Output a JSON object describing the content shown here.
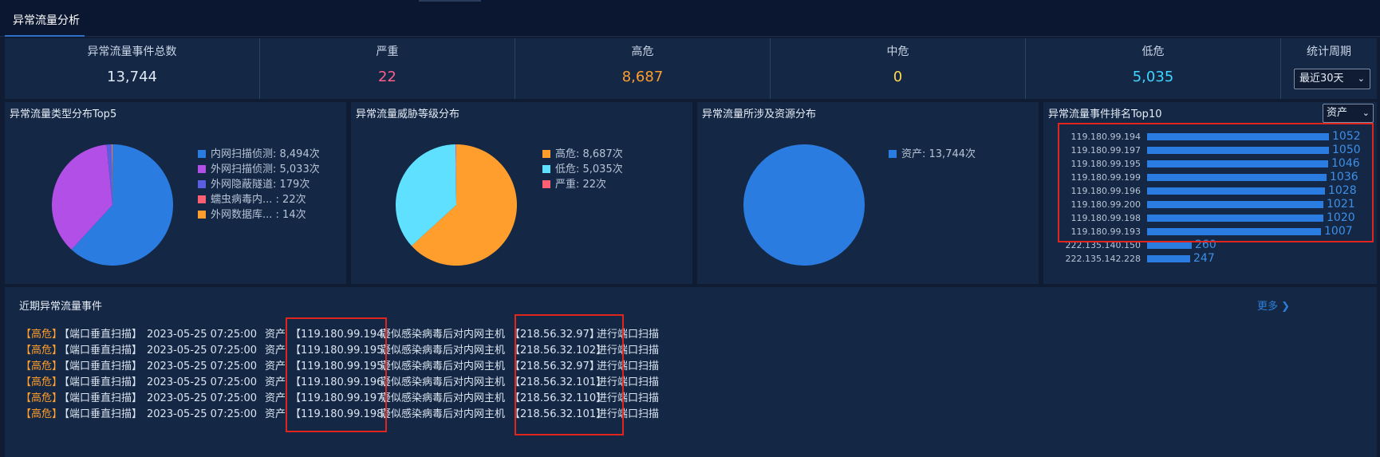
{
  "tab": {
    "label": "异常流量分析"
  },
  "stats": [
    {
      "label": "异常流量事件总数",
      "value": "13,744",
      "color": "#dfe7f3"
    },
    {
      "label": "严重",
      "value": "22",
      "color": "#ff5f8a"
    },
    {
      "label": "高危",
      "value": "8,687",
      "color": "#ff9e2c"
    },
    {
      "label": "中危",
      "value": "0",
      "color": "#ffd84d"
    },
    {
      "label": "低危",
      "value": "5,035",
      "color": "#3fd6ff"
    }
  ],
  "period": {
    "label": "统计周期",
    "selected": "最近30天"
  },
  "panels": {
    "type_dist": {
      "title": "异常流量类型分布Top5",
      "legend": [
        "内网扫描侦测: 8,494次",
        "外网扫描侦测: 5,033次",
        "外网隐蔽隧道: 179次",
        "蠕虫病毒内... : 22次",
        "外网数据库... : 14次"
      ]
    },
    "threat_dist": {
      "title": "异常流量威胁等级分布",
      "legend": [
        "高危: 8,687次",
        "低危: 5,035次",
        "严重: 22次"
      ]
    },
    "asset_dist": {
      "title": "异常流量所涉及资源分布",
      "legend": [
        "资产: 13,744次"
      ]
    },
    "rank": {
      "title": "异常流量事件排名Top10",
      "selector": "资产"
    }
  },
  "chart_data": [
    {
      "type": "pie",
      "title": "异常流量类型分布Top5",
      "categories": [
        "内网扫描侦测",
        "外网扫描侦测",
        "外网隐蔽隧道",
        "蠕虫病毒内...",
        "外网数据库..."
      ],
      "values": [
        8494,
        5033,
        179,
        22,
        14
      ],
      "colors": [
        "#2a7ce0",
        "#b14fe6",
        "#5a5fe0",
        "#ff5f72",
        "#ff9e2c"
      ]
    },
    {
      "type": "pie",
      "title": "异常流量威胁等级分布",
      "categories": [
        "高危",
        "低危",
        "严重"
      ],
      "values": [
        8687,
        5035,
        22
      ],
      "colors": [
        "#ff9e2c",
        "#5fe0ff",
        "#ff5f72"
      ]
    },
    {
      "type": "pie",
      "title": "异常流量所涉及资源分布",
      "categories": [
        "资产"
      ],
      "values": [
        13744
      ],
      "colors": [
        "#2a7ce0"
      ]
    },
    {
      "type": "bar",
      "title": "异常流量事件排名Top10",
      "categories": [
        "119.180.99.194",
        "119.180.99.197",
        "119.180.99.195",
        "119.180.99.199",
        "119.180.99.196",
        "119.180.99.200",
        "119.180.99.198",
        "119.180.99.193",
        "222.135.140.150",
        "222.135.142.228"
      ],
      "values": [
        1052,
        1050,
        1046,
        1036,
        1028,
        1021,
        1020,
        1007,
        260,
        247
      ]
    }
  ],
  "events": {
    "title": "近期异常流量事件",
    "more": "更多",
    "rows": [
      {
        "level": "【高危】",
        "category": "【端口垂直扫描】",
        "time": "2023-05-25 07:25:00",
        "asset_label": "资产",
        "src_ip": "【119.180.99.194】",
        "desc": "疑似感染病毒后对内网主机",
        "dst_ip": "【218.56.32.97】",
        "action": "进行端口扫描"
      },
      {
        "level": "【高危】",
        "category": "【端口垂直扫描】",
        "time": "2023-05-25 07:25:00",
        "asset_label": "资产",
        "src_ip": "【119.180.99.195】",
        "desc": "疑似感染病毒后对内网主机",
        "dst_ip": "【218.56.32.102】",
        "action": "进行端口扫描"
      },
      {
        "level": "【高危】",
        "category": "【端口垂直扫描】",
        "time": "2023-05-25 07:25:00",
        "asset_label": "资产",
        "src_ip": "【119.180.99.195】",
        "desc": "疑似感染病毒后对内网主机",
        "dst_ip": "【218.56.32.97】",
        "action": "进行端口扫描"
      },
      {
        "level": "【高危】",
        "category": "【端口垂直扫描】",
        "time": "2023-05-25 07:25:00",
        "asset_label": "资产",
        "src_ip": "【119.180.99.196】",
        "desc": "疑似感染病毒后对内网主机",
        "dst_ip": "【218.56.32.101】",
        "action": "进行端口扫描"
      },
      {
        "level": "【高危】",
        "category": "【端口垂直扫描】",
        "time": "2023-05-25 07:25:00",
        "asset_label": "资产",
        "src_ip": "【119.180.99.197】",
        "desc": "疑似感染病毒后对内网主机",
        "dst_ip": "【218.56.32.110】",
        "action": "进行端口扫描"
      },
      {
        "level": "【高危】",
        "category": "【端口垂直扫描】",
        "time": "2023-05-25 07:25:00",
        "asset_label": "资产",
        "src_ip": "【119.180.99.198】",
        "desc": "疑似感染病毒后对内网主机",
        "dst_ip": "【218.56.32.101】",
        "action": "进行端口扫描"
      }
    ]
  }
}
